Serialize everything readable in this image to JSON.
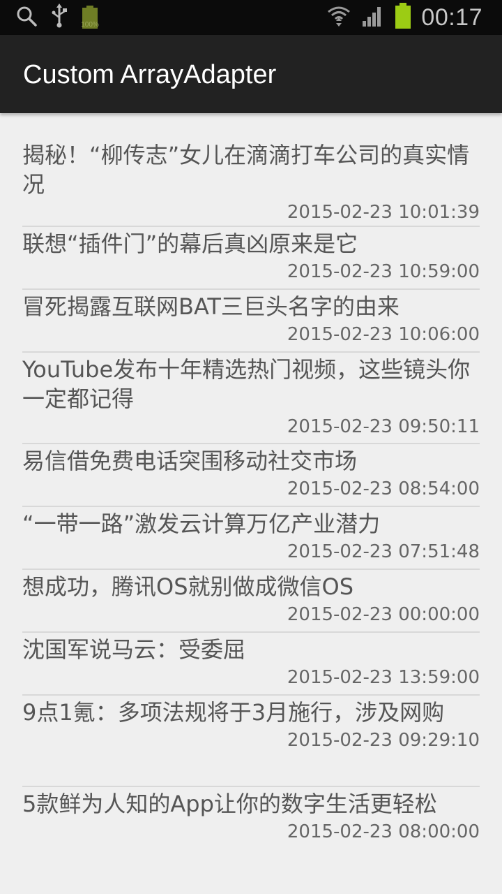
{
  "status_bar": {
    "time": "00:17",
    "battery_small_label": "100%",
    "icons": [
      "search-icon",
      "usb-icon",
      "battery-full-small-icon",
      "wifi-icon",
      "signal-icon",
      "battery-icon"
    ]
  },
  "app_bar": {
    "title": "Custom ArrayAdapter"
  },
  "news": [
    {
      "title": "揭秘！“柳传志”女儿在滴滴打车公司的真实情况",
      "date": "2015-02-23 10:01:39"
    },
    {
      "title": "联想“插件门”的幕后真凶原来是它",
      "date": "2015-02-23 10:59:00"
    },
    {
      "title": "冒死揭露互联网BAT三巨头名字的由来",
      "date": "2015-02-23 10:06:00"
    },
    {
      "title": "YouTube发布十年精选热门视频，这些镜头你一定都记得",
      "date": "2015-02-23 09:50:11"
    },
    {
      "title": "易信借免费电话突围移动社交市场",
      "date": "2015-02-23 08:54:00"
    },
    {
      "title": "“一带一路”激发云计算万亿产业潜力",
      "date": "2015-02-23 07:51:48"
    },
    {
      "title": "想成功，腾讯OS就别做成微信OS",
      "date": "2015-02-23 00:00:00"
    },
    {
      "title": "沈国军说马云：受委屈",
      "date": "2015-02-23 13:59:00"
    },
    {
      "title": "9点1氪：多项法规将于3月施行，涉及网购",
      "date": "2015-02-23 09:29:10"
    },
    {
      "title": "5款鲜为人知的App让你的数字生活更轻松",
      "date": "2015-02-23 08:00:00"
    }
  ],
  "colors": {
    "status_bar_bg": "#0b0b0b",
    "action_bar_bg": "#222222",
    "list_bg": "#efefef",
    "battery_green": "#9ccc14"
  }
}
